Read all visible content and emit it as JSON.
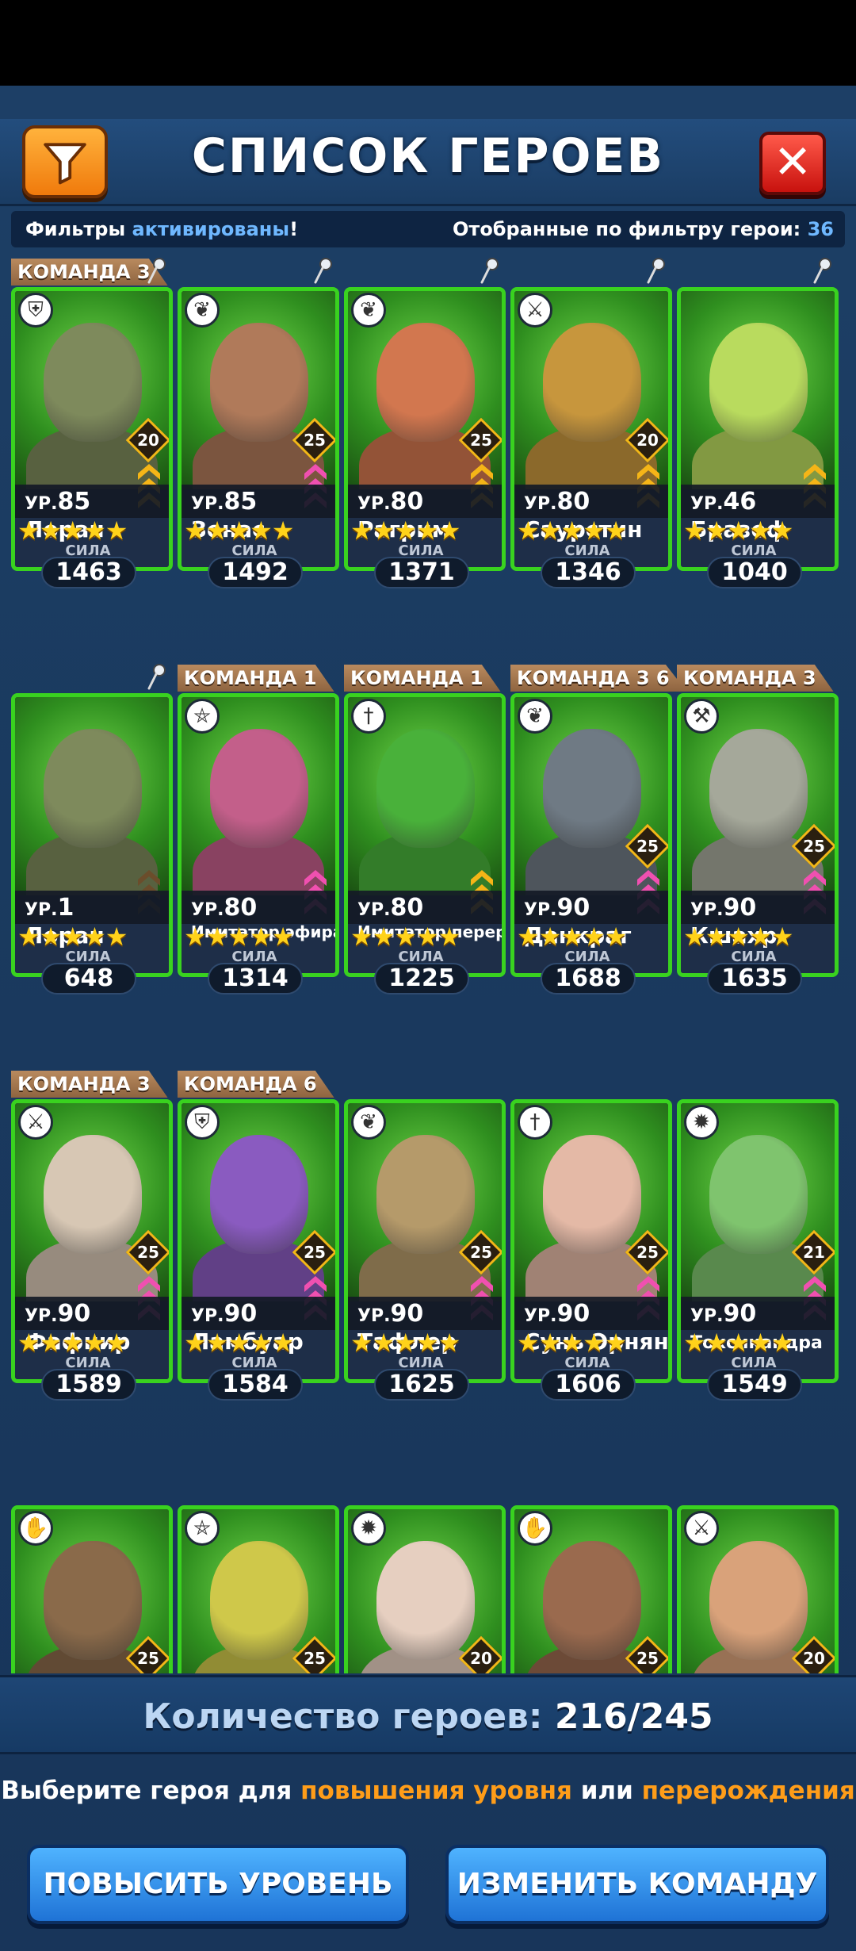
{
  "header": {
    "title": "СПИСОК ГЕРОЕВ"
  },
  "filter_bar": {
    "left_prefix": "Фильтры ",
    "left_accent": "активированы",
    "left_suffix": "!",
    "right_prefix": "Отобранные по фильтру герои: ",
    "right_value": "36"
  },
  "heroes": [
    {
      "team": "КОМАНДА 3",
      "pinned": true,
      "class_icon": "shield-icon",
      "level_label": "УР.",
      "level": "85",
      "rank": "20",
      "name": "Лоран",
      "stars": "★★★★★",
      "power_label": "СИЛА",
      "power": "1463",
      "tint": "#7e8a5c",
      "chevron": "#f5b517"
    },
    {
      "team": "",
      "pinned": true,
      "class_icon": "leaf-icon",
      "level_label": "УР.",
      "level": "85",
      "rank": "25",
      "name": "Зенас",
      "stars": "★★★★★",
      "power_label": "СИЛА",
      "power": "1492",
      "tint": "#b07a5a",
      "chevron": "#f050b0"
    },
    {
      "team": "",
      "pinned": true,
      "class_icon": "leaf-icon",
      "level_label": "УР.",
      "level": "80",
      "rank": "25",
      "name": "Рагрим",
      "stars": "★★★★★",
      "power_label": "СИЛА",
      "power": "1371",
      "tint": "#d2774f",
      "chevron": "#f5b517"
    },
    {
      "team": "",
      "pinned": true,
      "class_icon": "swords-icon",
      "level_label": "УР.",
      "level": "80",
      "rank": "20",
      "name": "Саурстин",
      "stars": "★★★★★",
      "power_label": "СИЛА",
      "power": "1346",
      "tint": "#c7963d",
      "chevron": "#f5b517"
    },
    {
      "team": "",
      "pinned": true,
      "class_icon": "",
      "level_label": "УР.",
      "level": "46",
      "rank": "",
      "name": "Бразеф",
      "stars": "★★★★★",
      "power_label": "СИЛА",
      "power": "1040",
      "tint": "#b9db5e",
      "chevron": "#f5b517"
    },
    {
      "team": "",
      "pinned": true,
      "class_icon": "",
      "level_label": "УР.",
      "level": "1",
      "rank": "",
      "name": "Лоран",
      "stars": "★★★★★",
      "power_label": "СИЛА",
      "power": "648",
      "tint": "#7e8a5c",
      "chevron": "#6b4d2b"
    },
    {
      "team": "КОМАНДА 1",
      "pinned": false,
      "class_icon": "pentagram-icon",
      "level_label": "УР.",
      "level": "80",
      "rank": "",
      "name": "Имитатор эфира",
      "small": true,
      "stars": "★★★★★",
      "power_label": "СИЛА",
      "power": "1314",
      "tint": "#c35f8a",
      "chevron": "#f050b0"
    },
    {
      "team": "КОМАНДА 1",
      "pinned": false,
      "class_icon": "dagger-icon",
      "level_label": "УР.",
      "level": "80",
      "rank": "",
      "name": "Имитатор перерождения",
      "small": true,
      "stars": "★★★★★",
      "power_label": "СИЛА",
      "power": "1225",
      "tint": "#49b13a",
      "chevron": "#f5b517"
    },
    {
      "team": "КОМАНДА 3 6",
      "pinned": false,
      "class_icon": "leaf-icon",
      "level_label": "УР.",
      "level": "90",
      "rank": "25",
      "name": "Данкраг",
      "stars": "★★★★★",
      "power_label": "СИЛА",
      "power": "1688",
      "tint": "#6f7a84",
      "chevron": "#f050b0"
    },
    {
      "team": "КОМАНДА 3",
      "pinned": false,
      "class_icon": "axe-icon",
      "level_label": "УР.",
      "level": "90",
      "rank": "25",
      "name": "Кшахр",
      "stars": "★★★★★",
      "power_label": "СИЛА",
      "power": "1635",
      "tint": "#a5a89a",
      "chevron": "#f050b0"
    },
    {
      "team": "КОМАНДА 3",
      "pinned": false,
      "class_icon": "swords-icon",
      "level_label": "УР.",
      "level": "90",
      "rank": "25",
      "name": "Фафнир",
      "stars": "★★★★★",
      "power_label": "СИЛА",
      "power": "1589",
      "tint": "#d7c7b4",
      "chevron": "#f050b0"
    },
    {
      "team": "КОМАНДА 6",
      "pinned": false,
      "class_icon": "shield-icon",
      "level_label": "УР.",
      "level": "90",
      "rank": "25",
      "name": "Ламбуар",
      "stars": "★★★★★",
      "power_label": "СИЛА",
      "power": "1584",
      "tint": "#8a5bc0",
      "chevron": "#f050b0"
    },
    {
      "team": "",
      "pinned": false,
      "class_icon": "leaf-icon",
      "level_label": "УР.",
      "level": "90",
      "rank": "25",
      "name": "Тафлер",
      "stars": "★★★★★",
      "power_label": "СИЛА",
      "power": "1625",
      "tint": "#b59a6a",
      "chevron": "#f050b0"
    },
    {
      "team": "",
      "pinned": false,
      "class_icon": "dagger-icon",
      "level_label": "УР.",
      "level": "90",
      "rank": "25",
      "name": "Сунь Эрнян",
      "stars": "★★★★★",
      "power_label": "СИЛА",
      "power": "1606",
      "tint": "#e4b9a6",
      "chevron": "#f050b0"
    },
    {
      "team": "",
      "pinned": false,
      "class_icon": "sun-icon",
      "level_label": "УР.",
      "level": "90",
      "rank": "21",
      "name": "Токсикандра",
      "small_name": true,
      "stars": "★★★★★",
      "power_label": "СИЛА",
      "power": "1549",
      "tint": "#7fc46e",
      "chevron": "#f050b0"
    },
    {
      "team": "",
      "pinned": false,
      "class_icon": "hand-icon",
      "level_label": "",
      "level": "",
      "rank": "25",
      "name": "",
      "stars": "",
      "power_label": "",
      "power": "",
      "tint": "#8a6a4a",
      "chevron": ""
    },
    {
      "team": "",
      "pinned": false,
      "class_icon": "pentagram-icon",
      "level_label": "",
      "level": "",
      "rank": "25",
      "name": "",
      "stars": "",
      "power_label": "",
      "power": "",
      "tint": "#cfc84a",
      "chevron": ""
    },
    {
      "team": "",
      "pinned": false,
      "class_icon": "sun-icon",
      "level_label": "",
      "level": "",
      "rank": "20",
      "name": "",
      "stars": "",
      "power_label": "",
      "power": "",
      "tint": "#e6cfc0",
      "chevron": ""
    },
    {
      "team": "",
      "pinned": false,
      "class_icon": "hand-icon",
      "level_label": "",
      "level": "",
      "rank": "25",
      "name": "",
      "stars": "",
      "power_label": "",
      "power": "",
      "tint": "#9a6a4e",
      "chevron": ""
    },
    {
      "team": "",
      "pinned": false,
      "class_icon": "swords-icon",
      "level_label": "",
      "level": "",
      "rank": "20",
      "name": "",
      "stars": "",
      "power_label": "",
      "power": "",
      "tint": "#d9a27a",
      "chevron": ""
    }
  ],
  "footer": {
    "count_label": "Количество героев:",
    "count_value": "216/245",
    "hint_prefix": "Выберите героя для ",
    "hint_level": "повышения уровня",
    "hint_mid": " или ",
    "hint_rebirth": "перерождения",
    "level_up_button": "ПОВЫСИТЬ УРОВЕНЬ",
    "change_team_button": "ИЗМЕНИТЬ КОМАНДУ"
  }
}
